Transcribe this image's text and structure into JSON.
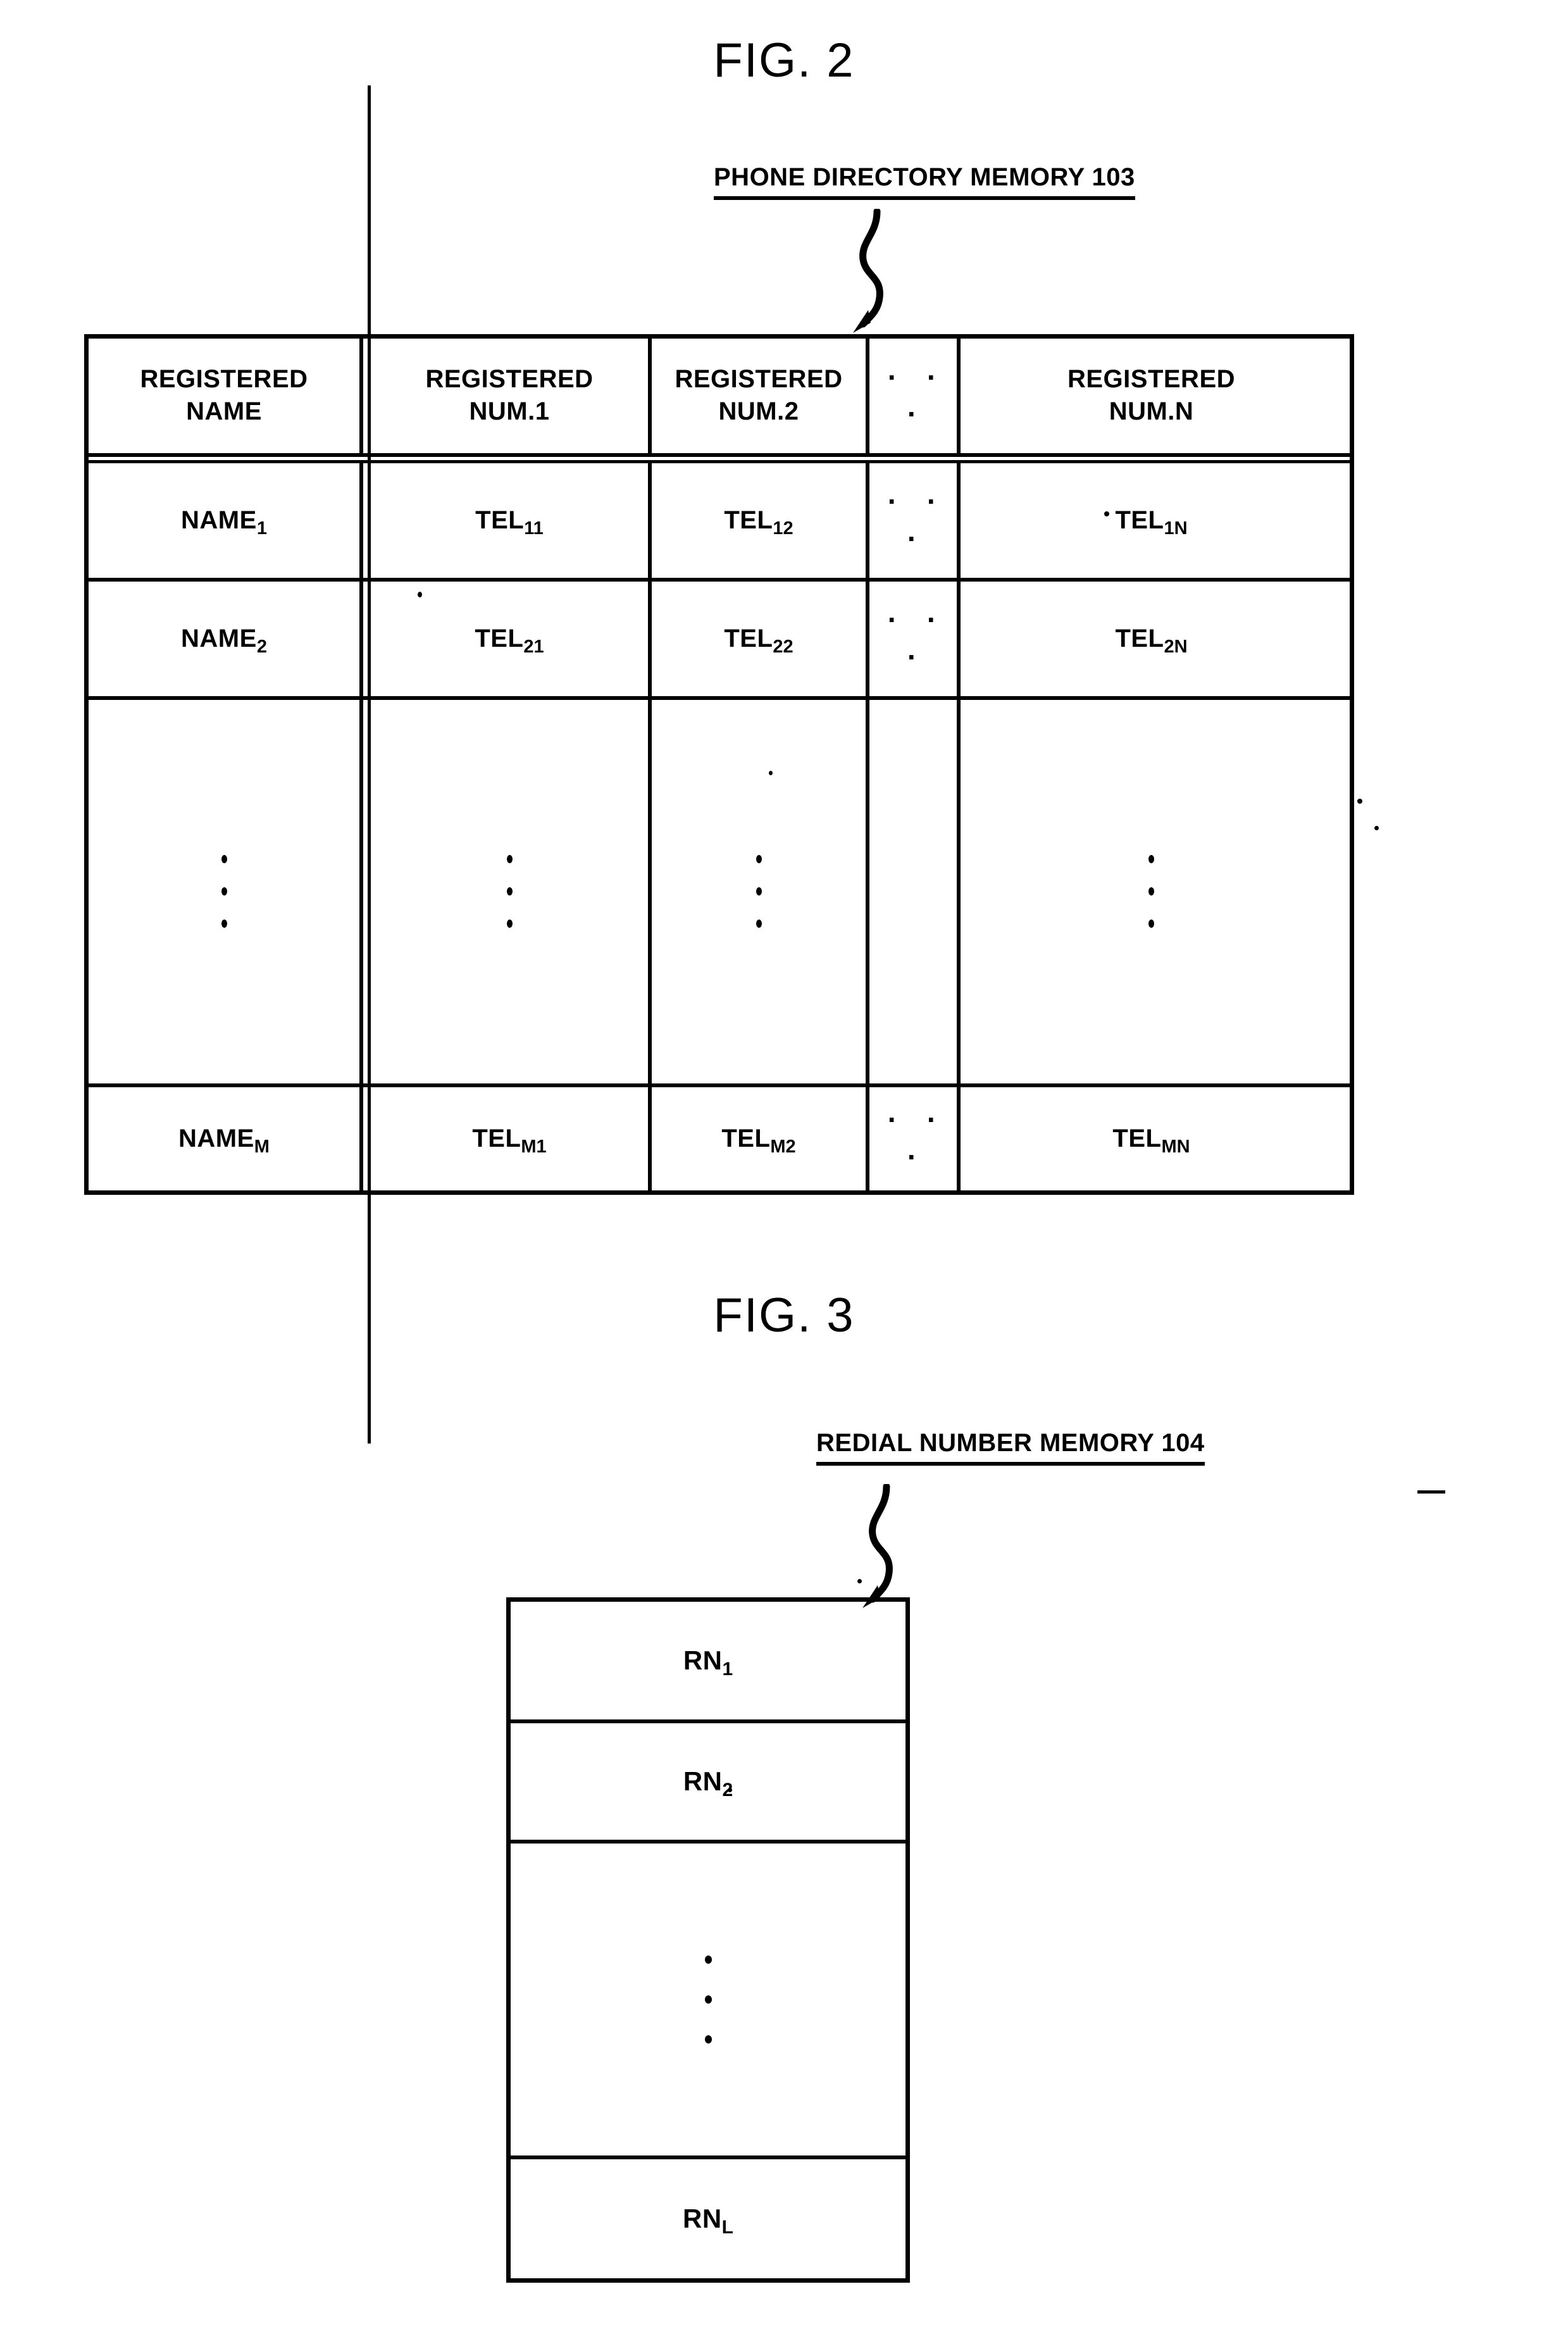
{
  "figures": [
    {
      "id": "fig2",
      "title": "FIG. 2",
      "callout": "PHONE DIRECTORY MEMORY 103",
      "table": {
        "headers": [
          {
            "line1": "REGISTERED",
            "line2": "NAME"
          },
          {
            "line1": "REGISTERED",
            "line2": "NUM.1"
          },
          {
            "line1": "REGISTERED",
            "line2": "NUM.2"
          },
          {
            "ellipsis": "· · ·"
          },
          {
            "line1": "REGISTERED",
            "line2": "NUM.N"
          }
        ],
        "rows": [
          {
            "name_base": "NAME",
            "name_sub": "1",
            "n1_base": "TEL",
            "n1_sub": "11",
            "n2_base": "TEL",
            "n2_sub": "12",
            "ellipsis": "· · ·",
            "nN_base": "TEL",
            "nN_sub": "1N"
          },
          {
            "name_base": "NAME",
            "name_sub": "2",
            "n1_base": "TEL",
            "n1_sub": "21",
            "n2_base": "TEL",
            "n2_sub": "22",
            "ellipsis": "· · ·",
            "nN_base": "TEL",
            "nN_sub": "2N"
          },
          {
            "name_base": "NAME",
            "name_sub": "M",
            "n1_base": "TEL",
            "n1_sub": "M1",
            "n2_base": "TEL",
            "n2_sub": "M2",
            "ellipsis": "· · ·",
            "nN_base": "TEL",
            "nN_sub": "MN"
          }
        ],
        "vertical_continuation": "⋮"
      }
    },
    {
      "id": "fig3",
      "title": "FIG. 3",
      "callout": "REDIAL NUMBER MEMORY 104",
      "cells": [
        {
          "base": "RN",
          "sub": "1"
        },
        {
          "base": "RN",
          "sub": "2"
        },
        {
          "continuation": "⋮"
        },
        {
          "base": "RN",
          "sub": "L"
        }
      ]
    }
  ],
  "colors": {
    "ink": "#000000",
    "paper": "#ffffff"
  },
  "icons": {
    "leader_arrow": "curved-leader-arrow"
  }
}
